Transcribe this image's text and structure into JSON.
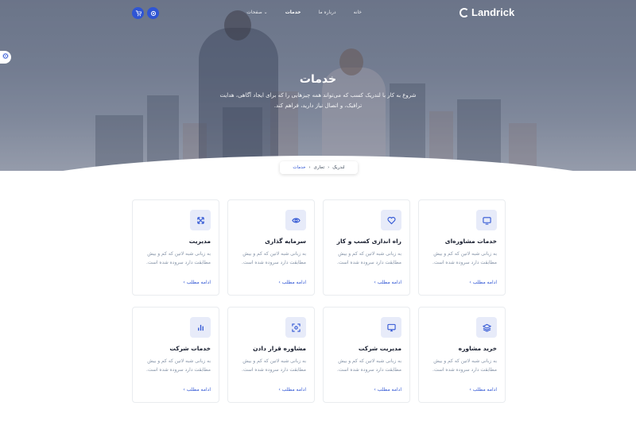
{
  "brand": {
    "name": "Landrick"
  },
  "nav": {
    "items": [
      {
        "label": "خانه",
        "active": false
      },
      {
        "label": "درباره ما",
        "active": false
      },
      {
        "label": "خدمات",
        "active": true
      },
      {
        "label": "صفحات",
        "active": false
      }
    ]
  },
  "hero": {
    "title": "خدمات",
    "subtitle": "شروع به کار با لندریک کسب که می‌تواند همه چیزهایی را که برای ایجاد آگاهی، هدایت ترافیک، و اتصال نیاز دارید، فراهم کند."
  },
  "breadcrumb": [
    "لندریک",
    "تجاری",
    "خدمات"
  ],
  "services": [
    {
      "title": "خدمات مشاوره‌ای",
      "icon": "monitor-icon",
      "text": "به زبانی شبه لاتین که کم و بیش مطابقت دارد سروده شده است.",
      "link": "ادامه مطلب"
    },
    {
      "title": "راه اندازی کسب و کار",
      "icon": "heart-icon",
      "text": "به زبانی شبه لاتین که کم و بیش مطابقت دارد سروده شده است.",
      "link": "ادامه مطلب"
    },
    {
      "title": "سرمایه گذاری",
      "icon": "eye-icon",
      "text": "به زبانی شبه لاتین که کم و بیش مطابقت دارد سروده شده است.",
      "link": "ادامه مطلب"
    },
    {
      "title": "مدیریت",
      "icon": "arrows-icon",
      "text": "به زبانی شبه لاتین که کم و بیش مطابقت دارد سروده شده است.",
      "link": "ادامه مطلب"
    },
    {
      "title": "خرید مشاوره",
      "icon": "layers-icon",
      "text": "به زبانی شبه لاتین که کم و بیش مطابقت دارد سروده شده است.",
      "link": "ادامه مطلب"
    },
    {
      "title": "مدیریت شرکت",
      "icon": "airplay-icon",
      "text": "به زبانی شبه لاتین که کم و بیش مطابقت دارد سروده شده است.",
      "link": "ادامه مطلب"
    },
    {
      "title": "مشاوره قرار دادن",
      "icon": "focus-icon",
      "text": "به زبانی شبه لاتین که کم و بیش مطابقت دارد سروده شده است.",
      "link": "ادامه مطلب"
    },
    {
      "title": "خدمات شرکت",
      "icon": "bar-chart-icon",
      "text": "به زبانی شبه لاتین که کم و بیش مطابقت دارد سروده شده است.",
      "link": "ادامه مطلب"
    }
  ],
  "colors": {
    "primary": "#2f55d4",
    "muted": "#8492a6",
    "heading": "#161c2d"
  }
}
